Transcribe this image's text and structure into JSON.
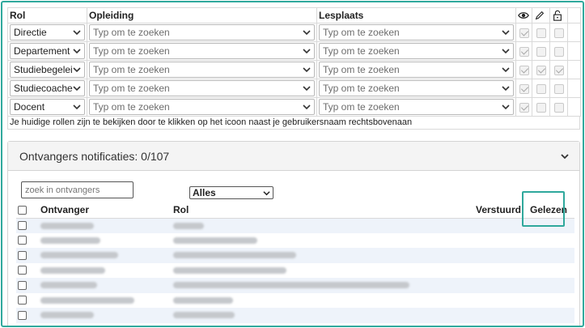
{
  "roles": {
    "headers": {
      "rol": "Rol",
      "opleiding": "Opleiding",
      "lesplaats": "Lesplaats"
    },
    "rows": [
      {
        "rol": "Directie",
        "opleiding": "Typ om te zoeken",
        "lesplaats": "Typ om te zoeken",
        "view": true,
        "edit": false,
        "lock": false
      },
      {
        "rol": "Departement",
        "opleiding": "Typ om te zoeken",
        "lesplaats": "Typ om te zoeken",
        "view": true,
        "edit": false,
        "lock": false
      },
      {
        "rol": "Studiebegelei",
        "opleiding": "Typ om te zoeken",
        "lesplaats": "Typ om te zoeken",
        "view": true,
        "edit": true,
        "lock": true
      },
      {
        "rol": "Studiecoache",
        "opleiding": "Typ om te zoeken",
        "lesplaats": "Typ om te zoeken",
        "view": true,
        "edit": false,
        "lock": false
      },
      {
        "rol": "Docent",
        "opleiding": "Typ om te zoeken",
        "lesplaats": "Typ om te zoeken",
        "view": true,
        "edit": false,
        "lock": false
      }
    ],
    "note": "Je huidige rollen zijn te bekijken door te klikken op het icoon naast je gebruikersnaam rechtsbovenaan"
  },
  "panel": {
    "title": "Ontvangers notificaties: 0/107",
    "search_placeholder": "zoek in ontvangers",
    "filter_selected": "Alles",
    "columns": {
      "ontvanger": "Ontvanger",
      "rol": "Rol",
      "verstuurd": "Verstuurd",
      "gelezen": "Gelezen"
    }
  },
  "recipients": [
    {
      "name_w": 66,
      "role_w": 38
    },
    {
      "name_w": 74,
      "role_w": 104
    },
    {
      "name_w": 96,
      "role_w": 152
    },
    {
      "name_w": 80,
      "role_w": 140
    },
    {
      "name_w": 70,
      "role_w": 292
    },
    {
      "name_w": 116,
      "role_w": 74
    },
    {
      "name_w": 66,
      "role_w": 76
    },
    {
      "name_w": 38,
      "role_w": 30
    }
  ],
  "colors": {
    "accent": "#2fa89c",
    "row_alt": "#eef3fa"
  }
}
